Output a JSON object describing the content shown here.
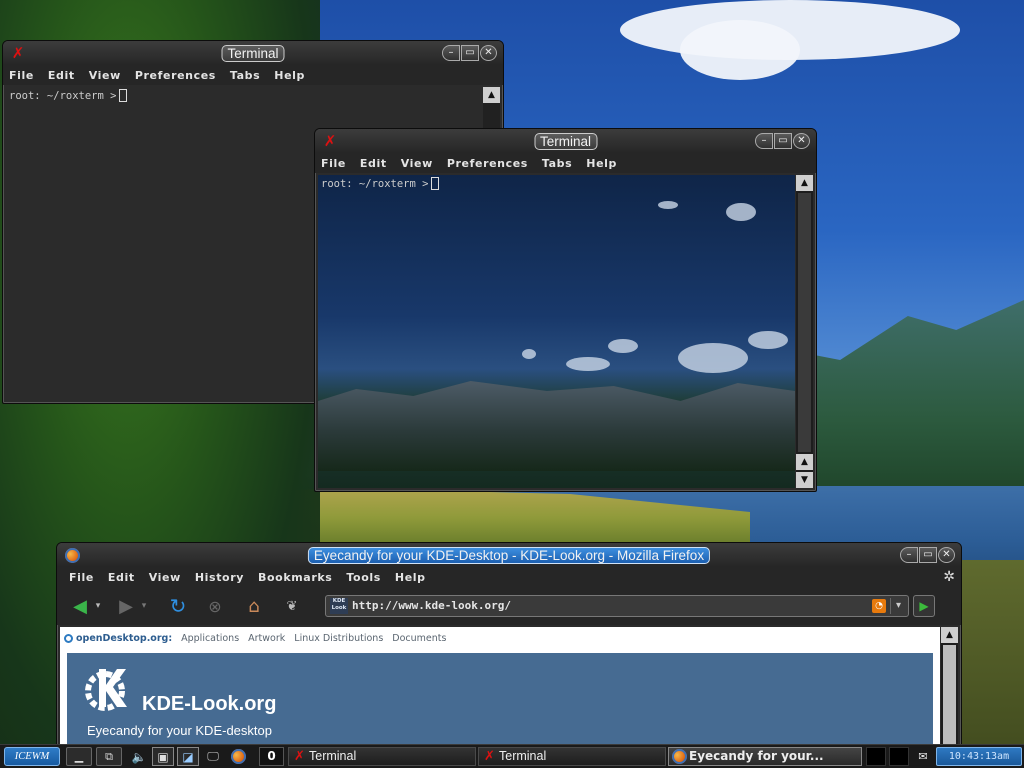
{
  "terminal1": {
    "title": "Terminal",
    "menu": [
      "File",
      "Edit",
      "View",
      "Preferences",
      "Tabs",
      "Help"
    ],
    "prompt": "root: ~/roxterm >"
  },
  "terminal2": {
    "title": "Terminal",
    "menu": [
      "File",
      "Edit",
      "View",
      "Preferences",
      "Tabs",
      "Help"
    ],
    "prompt": "root: ~/roxterm >"
  },
  "firefox": {
    "title": "Eyecandy for your KDE-Desktop - KDE-Look.org - Mozilla Firefox",
    "menu": [
      "File",
      "Edit",
      "View",
      "History",
      "Bookmarks",
      "Tools",
      "Help"
    ],
    "url": "http://www.kde-look.org/",
    "site_icon_label": "KDE Look",
    "page": {
      "opendesktop_brand": "openDesktop.org:",
      "nav_links": [
        "Applications",
        "Artwork",
        "Linux Distributions",
        "Documents"
      ],
      "banner_title": "KDE-Look.org",
      "banner_tagline": "Eyecandy for your KDE-desktop"
    }
  },
  "taskbar": {
    "start_label": "ICEWM",
    "workspace_counter": "0",
    "tasks": [
      {
        "label": "Terminal",
        "icon": "roxterm-x-icon",
        "active": false
      },
      {
        "label": "Terminal",
        "icon": "roxterm-x-icon",
        "active": false
      },
      {
        "label": "Eyecandy for your...",
        "icon": "firefox-icon",
        "active": true
      }
    ],
    "clock": "10:43:13am"
  },
  "colors": {
    "accent_blue": "#1c5fb0",
    "app_icon_red": "#d11111",
    "chrome_dark": "#262626"
  }
}
